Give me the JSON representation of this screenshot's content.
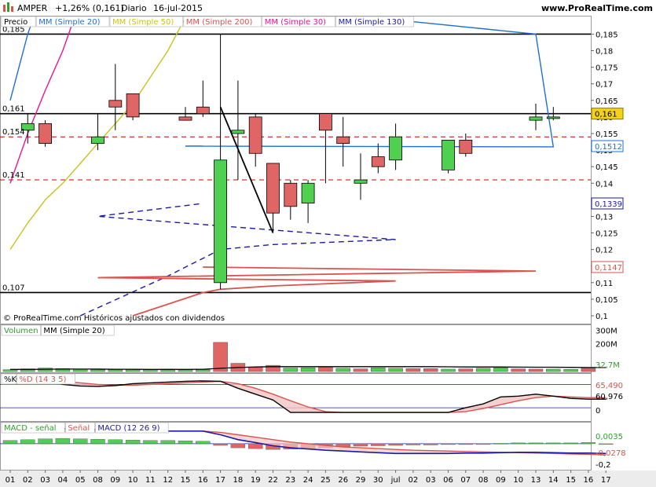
{
  "header": {
    "ticker": "AMPER",
    "change": "+1,26% (0,161)",
    "period": "Diario",
    "date": "16-jul-2015",
    "site": "www.ProRealTime.com"
  },
  "price_panel": {
    "legend": [
      {
        "label": "Precio",
        "color": "#000000"
      },
      {
        "label": "MM (Simple 20)",
        "color": "#1e6fd9"
      },
      {
        "label": "MM (Simple 50)",
        "color": "#c9c31c"
      },
      {
        "label": "MM (Simple 200)",
        "color": "#d9534f"
      },
      {
        "label": "MM (Simple 30)",
        "color": "#e8129b"
      },
      {
        "label": "MM (Simple 130)",
        "color": "#1a1aa8"
      }
    ],
    "watermark": "© ProRealTime.com  Históricos ajustados con dividendos",
    "left_labels": [
      "0,185",
      "0,161",
      "0,154",
      "0,141",
      "0,107"
    ],
    "y_ticks": [
      "0,185",
      "0,18",
      "0,175",
      "0,17",
      "0,165",
      "0,16",
      "0,155",
      "0,15",
      "0,145",
      "0,14",
      "0,135",
      "0,13",
      "0,125",
      "0,12",
      "0,115",
      "0,11",
      "0,105",
      "0,1"
    ],
    "tags": [
      {
        "text": "0,161",
        "bg": "#f5d21a",
        "fg": "#000000",
        "border": "#8a7300"
      },
      {
        "text": "0,1512",
        "bg": "#ffffff",
        "fg": "#1e6fd9",
        "border": "#1e6fd9"
      },
      {
        "text": "0,1339",
        "bg": "#ffffff",
        "fg": "#1a1aa8",
        "border": "#1a1aa8"
      },
      {
        "text": "0,1147",
        "bg": "#ffffff",
        "fg": "#d9534f",
        "border": "#d9534f"
      }
    ]
  },
  "volume_panel": {
    "legend": [
      {
        "label": "Volumen",
        "color": "#2ca02c"
      },
      {
        "label": "MM (Simple 20)",
        "color": "#000000"
      }
    ],
    "y_ticks": [
      "300M",
      "200M"
    ],
    "tags": [
      {
        "text": "32,7M",
        "fg": "#2ca02c"
      }
    ]
  },
  "stoch_panel": {
    "legend": [
      {
        "label": "%K",
        "color": "#000000"
      },
      {
        "label": "%D (14 3 5)",
        "color": "#d9534f"
      }
    ],
    "y_ticks": [
      "0"
    ],
    "tags": [
      {
        "text": "65,490",
        "fg": "#d9534f"
      },
      {
        "text": "60,976",
        "fg": "#000000"
      }
    ]
  },
  "macd_panel": {
    "legend": [
      {
        "label": "MACD - señal",
        "color": "#2ca02c"
      },
      {
        "label": "Señal",
        "color": "#d9534f"
      },
      {
        "label": "MACD (12 26 9)",
        "color": "#1a1aa8"
      }
    ],
    "y_ticks": [
      "-0,2"
    ],
    "tags": [
      {
        "text": "0,0035",
        "fg": "#2ca02c"
      },
      {
        "text": "-0,0278",
        "fg": "#d9534f"
      }
    ]
  },
  "x_axis": {
    "labels": [
      "01",
      "02",
      "03",
      "04",
      "05",
      "08",
      "09",
      "10",
      "11",
      "12",
      "15",
      "16",
      "17",
      "18",
      "19",
      "22",
      "23",
      "24",
      "25",
      "26",
      "29",
      "30",
      "jul",
      "02",
      "03",
      "06",
      "07",
      "08",
      "09",
      "10",
      "13",
      "14",
      "15",
      "16",
      "17"
    ]
  },
  "chart_data": {
    "type": "candlestick",
    "title": "AMPER  +1,26% (0,161)  Diario  16-jul-2015",
    "ylim": [
      0.1,
      0.187
    ],
    "categories": [
      "01",
      "02",
      "03",
      "04",
      "05",
      "08",
      "09",
      "10",
      "11",
      "12",
      "15",
      "16",
      "17",
      "18",
      "19",
      "22",
      "23",
      "24",
      "25",
      "26",
      "29",
      "30",
      "jul",
      "02",
      "03",
      "06",
      "07",
      "08",
      "09",
      "10",
      "13",
      "14",
      "15",
      "16",
      "17"
    ],
    "candles": [
      {
        "x": "17",
        "open": 0.11,
        "high": 0.185,
        "low": 0.108,
        "close": 0.147
      },
      {
        "x": "18",
        "open": 0.155,
        "high": 0.171,
        "low": 0.141,
        "close": 0.156
      },
      {
        "x": "19",
        "open": 0.16,
        "high": 0.161,
        "low": 0.145,
        "close": 0.149
      },
      {
        "x": "22",
        "open": 0.146,
        "high": 0.146,
        "low": 0.125,
        "close": 0.131
      },
      {
        "x": "23",
        "open": 0.14,
        "high": 0.141,
        "low": 0.129,
        "close": 0.133
      },
      {
        "x": "24",
        "open": 0.134,
        "high": 0.141,
        "low": 0.128,
        "close": 0.14
      },
      {
        "x": "25",
        "open": 0.161,
        "high": 0.161,
        "low": 0.14,
        "close": 0.156
      },
      {
        "x": "26",
        "open": 0.154,
        "high": 0.16,
        "low": 0.145,
        "close": 0.152
      },
      {
        "x": "29",
        "open": 0.14,
        "high": 0.149,
        "low": 0.135,
        "close": 0.141
      },
      {
        "x": "30",
        "open": 0.148,
        "high": 0.152,
        "low": 0.143,
        "close": 0.145
      },
      {
        "x": "jul",
        "open": 0.147,
        "high": 0.158,
        "low": 0.144,
        "close": 0.154
      },
      {
        "x": "02",
        "open": 0.156,
        "high": 0.161,
        "low": 0.152,
        "close": 0.158
      },
      {
        "x": "03",
        "open": 0.158,
        "high": 0.159,
        "low": 0.151,
        "close": 0.152
      },
      {
        "x": "06",
        "open": 0.144,
        "high": 0.153,
        "low": 0.143,
        "close": 0.153
      },
      {
        "x": "07",
        "open": 0.153,
        "high": 0.155,
        "low": 0.148,
        "close": 0.149
      },
      {
        "x": "08",
        "open": 0.152,
        "high": 0.161,
        "low": 0.15,
        "close": 0.154
      },
      {
        "x": "09",
        "open": 0.165,
        "high": 0.176,
        "low": 0.156,
        "close": 0.163
      },
      {
        "x": "10",
        "open": 0.167,
        "high": 0.167,
        "low": 0.159,
        "close": 0.16
      },
      {
        "x": "13",
        "open": 0.159,
        "high": 0.164,
        "low": 0.156,
        "close": 0.16
      },
      {
        "x": "14",
        "open": 0.16,
        "high": 0.163,
        "low": 0.159,
        "close": 0.16
      },
      {
        "x": "15",
        "open": 0.16,
        "high": 0.163,
        "low": 0.159,
        "close": 0.159
      },
      {
        "x": "16",
        "open": 0.163,
        "high": 0.171,
        "low": 0.16,
        "close": 0.161
      }
    ],
    "moving_averages": [
      {
        "name": "MM (Simple 20)",
        "color": "#1e6fd9",
        "points": [
          [
            "01",
            0.165
          ],
          [
            "02",
            0.185
          ],
          [
            "03",
            0.2
          ],
          [
            "13",
            0.185
          ],
          [
            "14",
            0.151
          ],
          [
            "15",
            0.1512
          ],
          [
            "16",
            0.1512
          ]
        ]
      },
      {
        "name": "MM (Simple 50)",
        "color": "#c9c31c",
        "points": [
          [
            "01",
            0.12
          ],
          [
            "02",
            0.128
          ],
          [
            "03",
            0.135
          ],
          [
            "04",
            0.14
          ],
          [
            "05",
            0.146
          ],
          [
            "08",
            0.152
          ],
          [
            "09",
            0.158
          ],
          [
            "10",
            0.164
          ],
          [
            "11",
            0.172
          ],
          [
            "12",
            0.18
          ],
          [
            "15",
            0.19
          ]
        ]
      },
      {
        "name": "MM (Simple 30)",
        "color": "#e8129b",
        "points": [
          [
            "01",
            0.14
          ],
          [
            "02",
            0.155
          ],
          [
            "03",
            0.168
          ],
          [
            "04",
            0.18
          ],
          [
            "05",
            0.195
          ]
        ]
      },
      {
        "name": "MM (Simple 130)",
        "color": "#1a1aa8",
        "points": [
          [
            "05",
            0.1
          ],
          [
            "12",
            0.112
          ],
          [
            "17",
            0.12
          ],
          [
            "22",
            0.1215
          ],
          [
            "jul",
            0.123
          ],
          [
            "08",
            0.13
          ],
          [
            "16",
            0.1339
          ]
        ]
      },
      {
        "name": "MM (Simple 200)",
        "color": "#d9534f",
        "points": [
          [
            "10",
            0.1
          ],
          [
            "16",
            0.107
          ],
          [
            "17",
            0.108
          ],
          [
            "22",
            0.109
          ],
          [
            "jul",
            0.1105
          ],
          [
            "08",
            0.1115
          ],
          [
            "13",
            0.1135
          ],
          [
            "16",
            0.1147
          ]
        ]
      }
    ],
    "hlines": [
      {
        "y": 0.185,
        "style": "solid",
        "color": "#000000"
      },
      {
        "y": 0.161,
        "style": "solid",
        "color": "#000000"
      },
      {
        "y": 0.154,
        "style": "dashed",
        "color": "#cc0000"
      },
      {
        "y": 0.141,
        "style": "dashed",
        "color": "#cc0000"
      },
      {
        "y": 0.107,
        "style": "solid",
        "color": "#000000"
      }
    ],
    "trendline": {
      "from": [
        "22",
        0.125
      ],
      "to": [
        "17",
        0.163
      ]
    },
    "volume": {
      "values": [
        8,
        14,
        20,
        16,
        12,
        8,
        8,
        8,
        8,
        12,
        8,
        8,
        210,
        55,
        28,
        40,
        20,
        22,
        28,
        18,
        14,
        22,
        18,
        16,
        16,
        12,
        14,
        18,
        22,
        14,
        12,
        12,
        10,
        18,
        0
      ],
      "ma": [
        10,
        10,
        11,
        12,
        12,
        12,
        11,
        11,
        10,
        10,
        10,
        11,
        18,
        24,
        28,
        30,
        30,
        30,
        30,
        30,
        30,
        30,
        30,
        30,
        30,
        29,
        28,
        28,
        28,
        27,
        26,
        26,
        25,
        24,
        24
      ],
      "ylim": [
        0,
        320
      ]
    },
    "stochastic": {
      "k": [
        95,
        92,
        88,
        80,
        76,
        75,
        77,
        82,
        84,
        86,
        88,
        89,
        88,
        70,
        55,
        40,
        8,
        8,
        8,
        8,
        8,
        8,
        8,
        8,
        8,
        8,
        20,
        30,
        48,
        50,
        55,
        50,
        44,
        42,
        42
      ],
      "d": [
        96,
        95,
        92,
        88,
        84,
        80,
        78,
        78,
        80,
        82,
        84,
        86,
        88,
        82,
        70,
        55,
        38,
        22,
        10,
        8,
        8,
        8,
        8,
        8,
        8,
        8,
        10,
        18,
        28,
        38,
        46,
        50,
        48,
        46,
        46
      ],
      "ylim": [
        -10,
        105
      ]
    },
    "macd": {
      "hist": [
        0.008,
        0.01,
        0.012,
        0.013,
        0.012,
        0.011,
        0.01,
        0.009,
        0.008,
        0.008,
        0.007,
        0.006,
        -0.004,
        -0.01,
        -0.012,
        -0.014,
        -0.013,
        -0.012,
        -0.01,
        -0.008,
        -0.006,
        -0.005,
        -0.004,
        -0.003,
        -0.003,
        -0.002,
        -0.001,
        0.0,
        0.001,
        0.002,
        0.002,
        0.002,
        0.002,
        0.003,
        0.0
      ],
      "signal": [
        0.03,
        0.03,
        0.031,
        0.031,
        0.031,
        0.031,
        0.031,
        0.031,
        0.031,
        0.031,
        0.031,
        0.031,
        0.028,
        0.022,
        0.016,
        0.01,
        0.004,
        0.0,
        -0.004,
        -0.008,
        -0.01,
        -0.012,
        -0.014,
        -0.016,
        -0.017,
        -0.018,
        -0.019,
        -0.02,
        -0.021,
        -0.022,
        -0.023,
        -0.024,
        -0.025,
        -0.026,
        -0.0278
      ],
      "macd": [
        0.035,
        0.036,
        0.037,
        0.037,
        0.036,
        0.035,
        0.034,
        0.033,
        0.032,
        0.031,
        0.031,
        0.031,
        0.022,
        0.01,
        0.003,
        -0.005,
        -0.01,
        -0.013,
        -0.016,
        -0.018,
        -0.02,
        -0.022,
        -0.024,
        -0.024,
        -0.024,
        -0.024,
        -0.023,
        -0.023,
        -0.022,
        -0.021,
        -0.021,
        -0.022,
        -0.023,
        -0.023,
        -0.024
      ],
      "ylim": [
        -0.06,
        0.05
      ]
    }
  }
}
